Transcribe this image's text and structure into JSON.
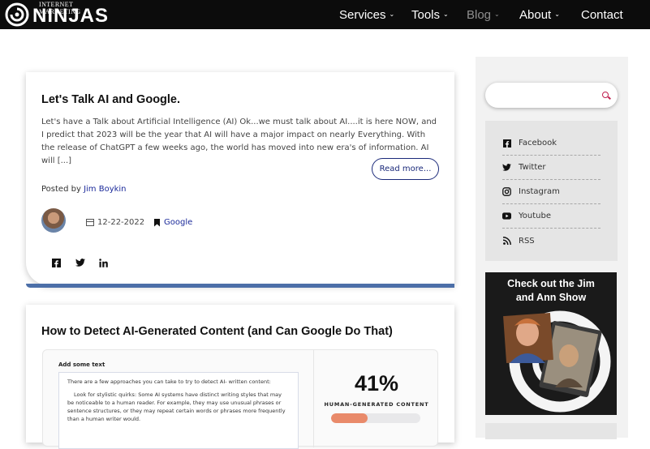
{
  "header": {
    "logo_small": "INTERNET MARKETING",
    "logo_big": "NINJAS",
    "nav": [
      {
        "label": "Services",
        "has_dropdown": true
      },
      {
        "label": "Tools",
        "has_dropdown": true
      },
      {
        "label": "Blog",
        "has_dropdown": true,
        "active": true
      },
      {
        "label": "About",
        "has_dropdown": true
      },
      {
        "label": "Contact",
        "has_dropdown": false
      }
    ]
  },
  "posts": [
    {
      "title": "Let's Talk AI and Google.",
      "excerpt": "Let's have a Talk about Artificial Intelligence (AI) Ok...we must talk about AI....it is here NOW, and I predict that 2023 will be the year that AI will have a major impact on nearly Everything. With the release of ChatGPT a few weeks ago, the world has moved into new era's of information. AI will [...]",
      "read_more": "Read more...",
      "posted_by_prefix": "Posted by",
      "author": "Jim Boykin",
      "date": "12-22-2022",
      "category": "Google",
      "share_icons": [
        "facebook-icon",
        "twitter-icon",
        "linkedin-icon"
      ]
    },
    {
      "title": "How to Detect AI-Generated Content (and Can Google Do That)",
      "embed": {
        "label": "Add some text",
        "paragraphs": [
          "There are a few approaches you can take to try to detect AI- written content:",
          "Look for stylistic quirks: Some AI systems have distinct writing styles that may be noticeable to a human reader. For example, they may use unusual phrases or sentence structures, or they may repeat certain words or phrases more frequently than a human writer would."
        ],
        "percent": "41%",
        "percent_label": "HUMAN-GENERATED CONTENT",
        "percent_value": 0.41
      }
    }
  ],
  "sidebar": {
    "search_placeholder": "",
    "social": [
      {
        "label": "Facebook",
        "icon": "facebook-icon"
      },
      {
        "label": "Twitter",
        "icon": "twitter-icon"
      },
      {
        "label": "Instagram",
        "icon": "instagram-icon"
      },
      {
        "label": "Youtube",
        "icon": "youtube-icon"
      },
      {
        "label": "RSS",
        "icon": "rss-icon"
      }
    ],
    "show_title": "Check out the Jim and Ann Show"
  },
  "colors": {
    "topbar": "#0c0c0c",
    "link": "#1b2a9a",
    "accent_bar": "#4c6fa8",
    "search_icon": "#c02050",
    "progress_fill": "#e98a6a"
  }
}
